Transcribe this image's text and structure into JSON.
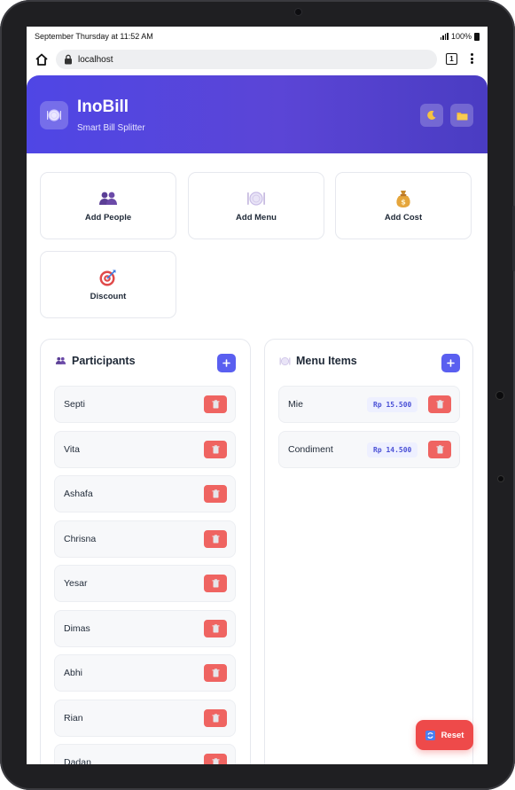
{
  "statusbar": {
    "time": "September Thursday at 11:52 AM",
    "battery": "100%"
  },
  "browser": {
    "url": "localhost",
    "tab_count": "1"
  },
  "header": {
    "title": "InoBill",
    "subtitle": "Smart Bill Splitter"
  },
  "actions": [
    {
      "label": "Add People",
      "icon": "people-icon"
    },
    {
      "label": "Add Menu",
      "icon": "plate-icon"
    },
    {
      "label": "Add Cost",
      "icon": "money-bag-icon"
    },
    {
      "label": "Discount",
      "icon": "target-icon"
    }
  ],
  "participants": {
    "title": "Participants",
    "items": [
      "Septi",
      "Vita",
      "Ashafa",
      "Chrisna",
      "Yesar",
      "Dimas",
      "Abhi",
      "Rian",
      "Dadan"
    ]
  },
  "menu": {
    "title": "Menu Items",
    "items": [
      {
        "name": "Mie",
        "price": "Rp 15.500"
      },
      {
        "name": "Condiment",
        "price": "Rp 14.500"
      }
    ]
  },
  "reset_label": "Reset",
  "colors": {
    "accent": "#5a5ff0",
    "header_gradient_start": "#4f46e5",
    "danger": "#ef6461"
  }
}
